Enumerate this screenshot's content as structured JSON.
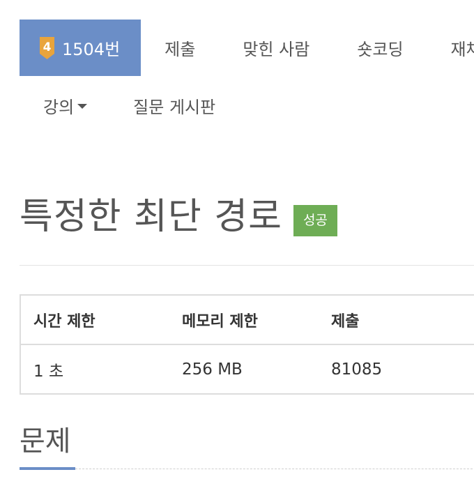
{
  "nav": {
    "tabs": [
      {
        "label": "1504번",
        "active": true,
        "tier": "4"
      },
      {
        "label": "제출"
      },
      {
        "label": "맞힌 사람"
      },
      {
        "label": "숏코딩"
      },
      {
        "label": "재채점"
      }
    ],
    "row2": [
      {
        "label": "강의"
      },
      {
        "label": "질문 게시판"
      }
    ]
  },
  "problem": {
    "title": "특정한 최단 경로",
    "result_badge": "성공"
  },
  "info_table": {
    "headers": [
      "시간 제한",
      "메모리 제한",
      "제출"
    ],
    "values": [
      "1 초",
      "256 MB",
      "81085"
    ]
  },
  "section": {
    "title": "문제"
  },
  "colors": {
    "accent": "#6b8ec7",
    "success": "#6ead55",
    "tier_gold": "#e9a43c"
  }
}
